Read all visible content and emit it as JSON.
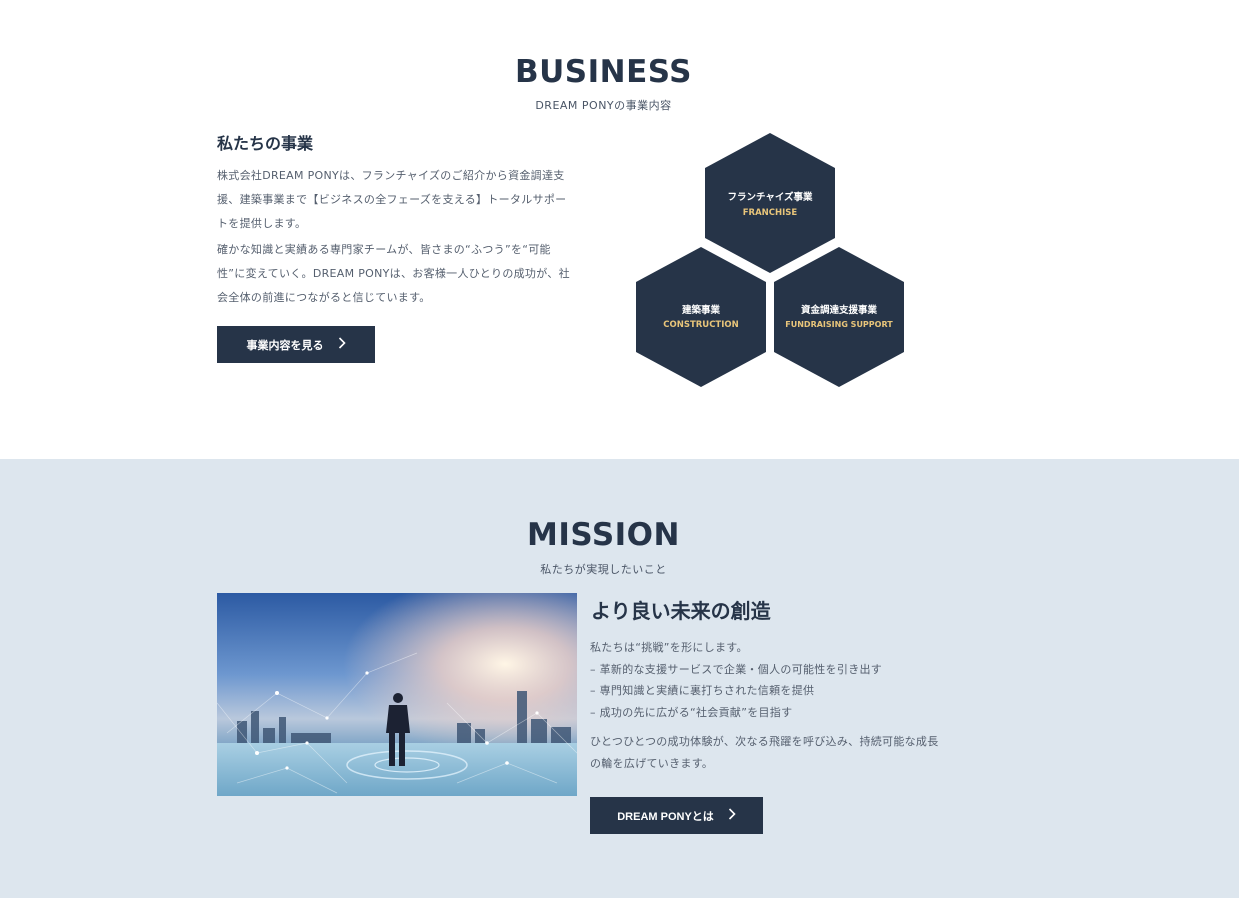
{
  "business": {
    "title": "BUSINESS",
    "subtitle": "DREAM PONYの事業内容",
    "heading": "私たちの事業",
    "paragraph1_lines": [
      "株式会社DREAM PONYは、フランチャイズのご紹介から資金調達支",
      "援、建築事業まで【ビジネスの全フェーズを支える】トータルサポー",
      "トを提供します。"
    ],
    "paragraph2_lines": [
      "確かな知識と実績ある専門家チームが、皆さまの“ふつう”を“可能",
      "性”に変えていく。DREAM PONYは、お客様一人ひとりの成功が、社",
      "会全体の前進につながると信じています。"
    ],
    "button_label": "事業内容を見る",
    "hexagons": [
      {
        "jp": "フランチャイズ事業",
        "en": "FRANCHISE"
      },
      {
        "jp": "建築事業",
        "en": "CONSTRUCTION"
      },
      {
        "jp": "資金調達支援事業",
        "en": "FUNDRAISING SUPPORT"
      }
    ]
  },
  "mission": {
    "title": "MISSION",
    "subtitle": "私たちが実現したいこと",
    "heading": "より良い未来の創造",
    "lines": [
      "私たちは“挑戦”を形にします。",
      "– 革新的な支援サービスで企業・個人の可能性を引き出す",
      "– 専門知識と実績に裏打ちされた信頼を提供",
      "– 成功の先に広がる“社会貢献”を目指す"
    ],
    "paragraph2_lines": [
      "ひとつひとつの成功体験が、次なる飛躍を呼び込み、持続可能な成長",
      "の輪を広げていきます。"
    ],
    "button_label": "DREAM PONYとは"
  },
  "colors": {
    "navy": "#263448",
    "gold": "#e8c57a",
    "mission_bg": "#dde6ee"
  },
  "icons": {
    "button_arrow": "chevron-right-icon"
  }
}
